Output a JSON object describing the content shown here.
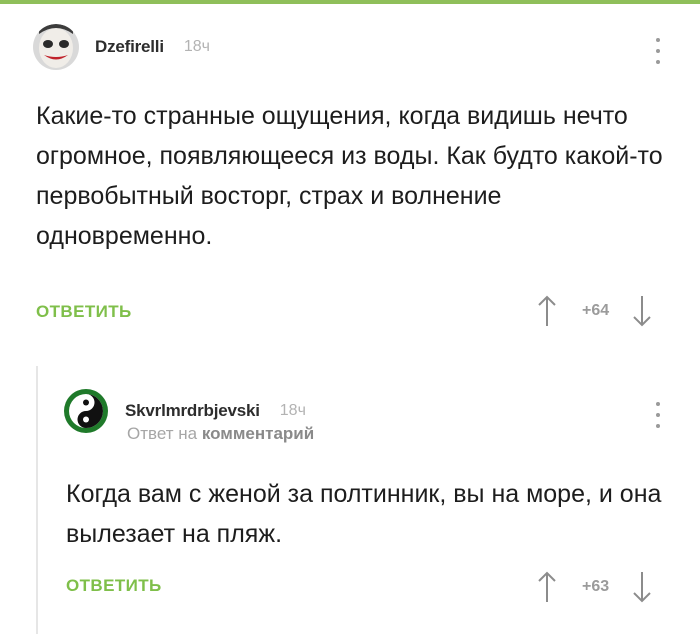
{
  "colors": {
    "accent_green": "#7fbf4a",
    "muted_text": "#a6a6a6",
    "body_text": "#1d1d1d"
  },
  "comments": [
    {
      "username": "Dzefirelli",
      "time": "18ч",
      "avatar_icon": "joker-avatar-icon",
      "text": "Какие-то странные ощущения, когда видишь нечто огромное, появляющееся из воды. Как будто какой-то первобытный восторг, страх и волнение одновременно.",
      "reply_label": "ОТВЕТИТЬ",
      "rating": "+64"
    },
    {
      "username": "Skvrlmrdrbjevski",
      "time": "18ч",
      "avatar_icon": "yin-yang-avatar-icon",
      "reply_to_prefix": "Ответ на",
      "reply_to_link": "комментарий",
      "text": "Когда вам с женой за полтинник, вы на море, и она вылезает на пляж.",
      "reply_label": "ОТВЕТИТЬ",
      "rating": "+63"
    }
  ]
}
